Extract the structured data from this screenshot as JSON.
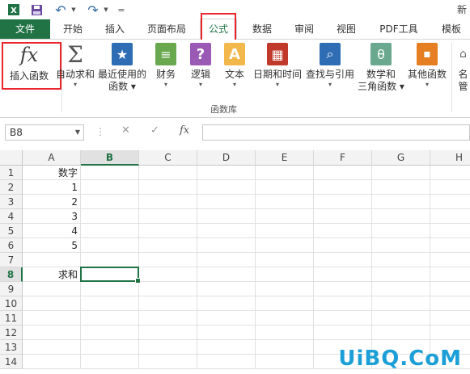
{
  "window": {
    "title": "新"
  },
  "qat": {
    "undo_glyph": "↶",
    "redo_glyph": "↷",
    "customize_glyph": "="
  },
  "tabs": [
    {
      "label": "文件"
    },
    {
      "label": "开始"
    },
    {
      "label": "插入"
    },
    {
      "label": "页面布局"
    },
    {
      "label": "公式"
    },
    {
      "label": "数据"
    },
    {
      "label": "审阅"
    },
    {
      "label": "视图"
    },
    {
      "label": "PDF工具"
    },
    {
      "label": "模板"
    }
  ],
  "ribbon": {
    "insert_function": {
      "glyph": "fx",
      "label": "插入函数"
    },
    "buttons": [
      {
        "line1": "自动求和",
        "line2": "▾",
        "glyph": "Σ"
      },
      {
        "line1": "最近使用的",
        "line2": "函数 ▾",
        "glyph": "★"
      },
      {
        "line1": "财务",
        "line2": "▾",
        "glyph": "≡"
      },
      {
        "line1": "逻辑",
        "line2": "▾",
        "glyph": "?"
      },
      {
        "line1": "文本",
        "line2": "▾",
        "glyph": "A"
      },
      {
        "line1": "日期和时间",
        "line2": "▾",
        "glyph": "▦"
      },
      {
        "line1": "查找与引用",
        "line2": "▾",
        "glyph": "⌕"
      },
      {
        "line1": "数学和",
        "line2": "三角函数 ▾",
        "glyph": "θ"
      },
      {
        "line1": "其他函数",
        "line2": "▾",
        "glyph": "▪"
      },
      {
        "line1": "名",
        "line2": "管",
        "glyph": "⌂"
      }
    ],
    "group_label": "函数库"
  },
  "formula_bar": {
    "name_box": "B8",
    "dropdown_glyph": "▼",
    "dots_glyph": "⋮",
    "cancel_glyph": "✕",
    "enter_glyph": "✓",
    "fx_glyph": "fx"
  },
  "sheet": {
    "columns": [
      "A",
      "B",
      "C",
      "D",
      "E",
      "F",
      "G",
      "H"
    ],
    "rows": [
      "1",
      "2",
      "3",
      "4",
      "5",
      "6",
      "7",
      "8",
      "9",
      "10",
      "11",
      "12",
      "13",
      "14"
    ],
    "cells": [
      {
        "row": 1,
        "col": 0,
        "value": "数字"
      },
      {
        "row": 2,
        "col": 0,
        "value": "1"
      },
      {
        "row": 3,
        "col": 0,
        "value": "2"
      },
      {
        "row": 4,
        "col": 0,
        "value": "3"
      },
      {
        "row": 5,
        "col": 0,
        "value": "4"
      },
      {
        "row": 6,
        "col": 0,
        "value": "5"
      },
      {
        "row": 8,
        "col": 0,
        "value": "求和"
      }
    ],
    "selected": {
      "row": 8,
      "col": 1
    }
  },
  "watermark": "UiBQ.CoM",
  "colors": {
    "excel_green": "#217346",
    "highlight_red": "#e8262c",
    "watermark_blue": "#1c9fd6"
  }
}
